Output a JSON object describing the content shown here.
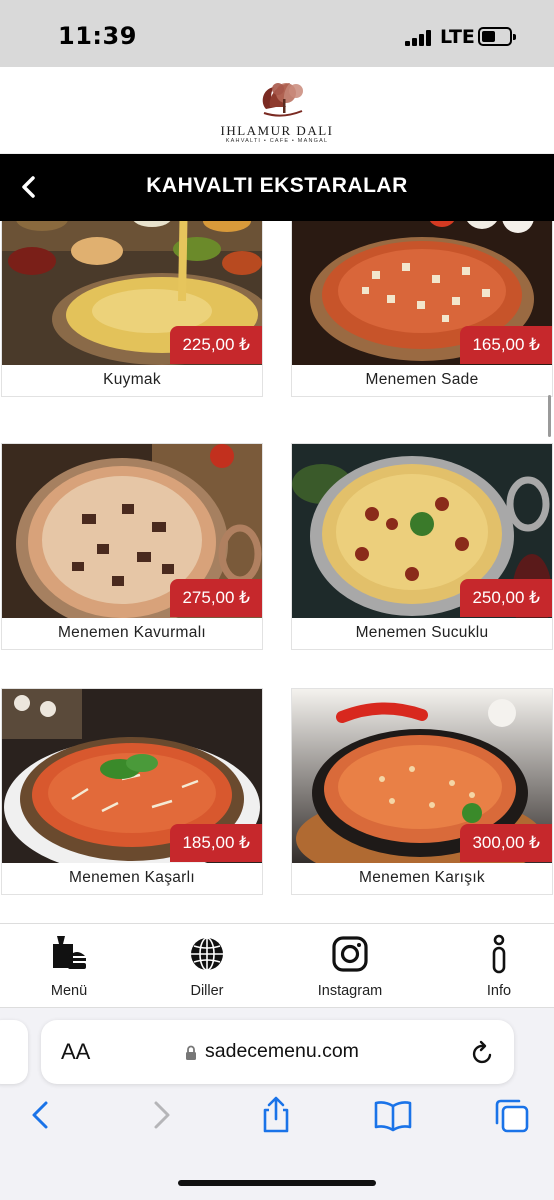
{
  "status": {
    "time": "11:39",
    "network": "LTE"
  },
  "brand": {
    "name": "IHLAMUR DALI",
    "tagline": "KAHVALTI • CAFE • MANGAL",
    "accent_color": "#c6282c"
  },
  "header": {
    "title": "KAHVALTI EKSTARALAR",
    "back_icon": "chevron-left-icon"
  },
  "menu_items": [
    {
      "name": "Kuymak",
      "price": "225,00 ₺"
    },
    {
      "name": "Menemen Sade",
      "price": "165,00 ₺"
    },
    {
      "name": "Menemen Kavurmalı",
      "price": "275,00 ₺"
    },
    {
      "name": "Menemen Sucuklu",
      "price": "250,00 ₺"
    },
    {
      "name": "Menemen Kaşarlı",
      "price": "185,00 ₺"
    },
    {
      "name": "Menemen Karışık",
      "price": "300,00 ₺"
    }
  ],
  "bottom_nav": [
    {
      "label": "Menü",
      "icon": "food-menu-icon"
    },
    {
      "label": "Diller",
      "icon": "globe-icon"
    },
    {
      "label": "Instagram",
      "icon": "instagram-icon"
    },
    {
      "label": "Info",
      "icon": "info-icon"
    }
  ],
  "browser": {
    "aa_label": "AA",
    "url": "sadecemenu.com"
  }
}
